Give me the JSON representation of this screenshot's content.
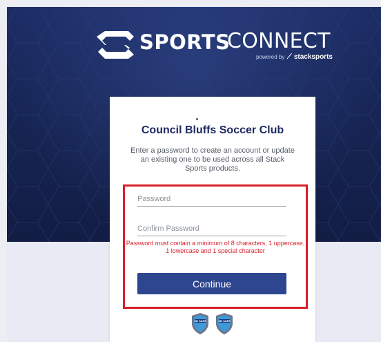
{
  "brand": {
    "sports": "SPORTS",
    "connect": "CONNECT",
    "powered_by": "powered by",
    "stack_sports": "stacksports"
  },
  "card": {
    "club_name": "Council Bluffs Soccer Club",
    "intro": "Enter a password to create an account or update an existing one to be used across all Stack Sports products."
  },
  "form": {
    "password_placeholder": "Password",
    "confirm_placeholder": "Confirm Password",
    "error": "Password must contain a minimum of 8 characters, 1 uppercase, 1 lowercase and 1 special character",
    "continue_label": "Continue"
  },
  "badges": [
    {
      "label": "SD SAFE",
      "icon": "safe-sport-shield-icon"
    },
    {
      "label": "SD SAFE",
      "icon": "safe-sport-shield-icon"
    }
  ],
  "colors": {
    "hero_dark": "#15234f",
    "title_navy": "#1d2b63",
    "button_blue": "#2e4690",
    "error_red": "#d81e2a"
  }
}
